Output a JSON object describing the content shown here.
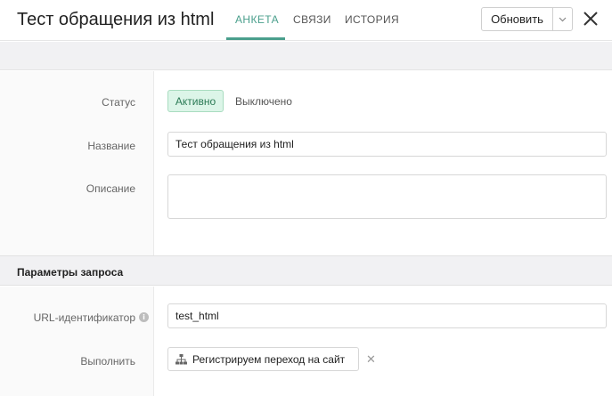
{
  "header": {
    "title": "Тест обращения из html",
    "tabs": [
      {
        "label": "АНКЕТА",
        "active": true
      },
      {
        "label": "СВЯЗИ",
        "active": false
      },
      {
        "label": "ИСТОРИЯ",
        "active": false
      }
    ],
    "refresh_label": "Обновить",
    "accent_color": "#4a9f8c"
  },
  "form": {
    "status_label": "Статус",
    "status_active": "Активно",
    "status_off": "Выключено",
    "name_label": "Название",
    "name_value": "Тест обращения из html",
    "description_label": "Описание",
    "description_value": ""
  },
  "request_params": {
    "title": "Параметры запроса",
    "url_label": "URL-идентификатор",
    "url_value": "test_html",
    "execute_label": "Выполнить",
    "execute_value": "Регистрируем переход на сайт"
  },
  "icons": {
    "info": "i",
    "remove": "✕"
  }
}
